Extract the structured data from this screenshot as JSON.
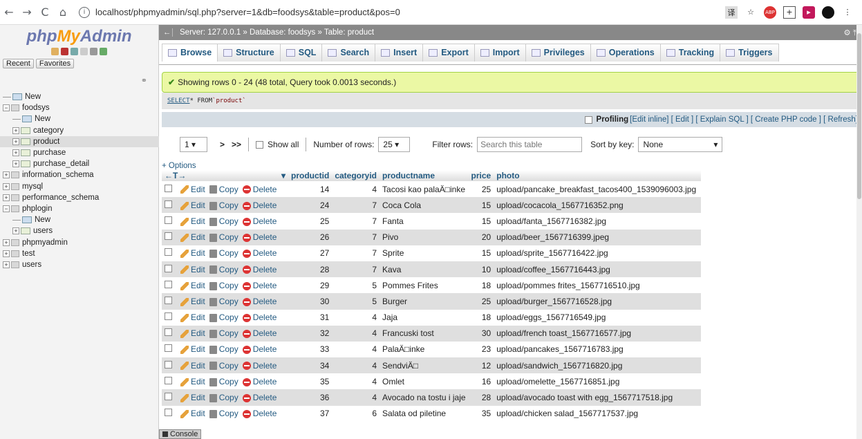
{
  "browser": {
    "url": "localhost/phpmyadmin/sql.php?server=1&db=foodsys&table=product&pos=0"
  },
  "pma": {
    "logo_php": "php",
    "logo_my": "My",
    "logo_admin": "Admin",
    "recent": "Recent",
    "favorites": "Favorites"
  },
  "tree": [
    {
      "label": "New",
      "level": 0,
      "type": "new",
      "selected": false
    },
    {
      "label": "foodsys",
      "level": 0,
      "type": "db",
      "selected": false
    },
    {
      "label": "New",
      "level": 1,
      "type": "new",
      "selected": false
    },
    {
      "label": "category",
      "level": 1,
      "type": "table",
      "selected": false
    },
    {
      "label": "product",
      "level": 1,
      "type": "table",
      "selected": true
    },
    {
      "label": "purchase",
      "level": 1,
      "type": "table",
      "selected": false
    },
    {
      "label": "purchase_detail",
      "level": 1,
      "type": "table",
      "selected": false
    },
    {
      "label": "information_schema",
      "level": 0,
      "type": "db",
      "selected": false
    },
    {
      "label": "mysql",
      "level": 0,
      "type": "db",
      "selected": false
    },
    {
      "label": "performance_schema",
      "level": 0,
      "type": "db",
      "selected": false
    },
    {
      "label": "phplogin",
      "level": 0,
      "type": "db",
      "selected": false
    },
    {
      "label": "New",
      "level": 1,
      "type": "new",
      "selected": false
    },
    {
      "label": "users",
      "level": 1,
      "type": "table",
      "selected": false
    },
    {
      "label": "phpmyadmin",
      "level": 0,
      "type": "db",
      "selected": false
    },
    {
      "label": "test",
      "level": 0,
      "type": "db",
      "selected": false
    },
    {
      "label": "users",
      "level": 0,
      "type": "db",
      "selected": false
    }
  ],
  "breadcrumb": "Server: 127.0.0.1 » Database: foodsys » Table: product",
  "tabs": [
    "Browse",
    "Structure",
    "SQL",
    "Search",
    "Insert",
    "Export",
    "Import",
    "Privileges",
    "Operations",
    "Tracking",
    "Triggers"
  ],
  "message": "Showing rows 0 - 24 (48 total, Query took 0.0013 seconds.)",
  "sql": {
    "kw": "SELECT",
    "mid": " * FROM ",
    "str": "`product`"
  },
  "profiling": {
    "label": "Profiling",
    "links": "[Edit inline] [ Edit ] [ Explain SQL ] [ Create PHP code ] [ Refresh]"
  },
  "pager": {
    "page": "1",
    "next": ">",
    "last": ">>",
    "show_all": "Show all",
    "num_rows_label": "Number of rows:",
    "num_rows": "25",
    "filter_label": "Filter rows:",
    "filter_placeholder": "Search this table",
    "sort_label": "Sort by key:",
    "sort_value": "None"
  },
  "options_label": "+ Options",
  "columns": [
    "productid",
    "categoryid",
    "productname",
    "price",
    "photo"
  ],
  "action_labels": {
    "edit": "Edit",
    "copy": "Copy",
    "delete": "Delete"
  },
  "rows": [
    [
      "14",
      "4",
      "Tacosi kao palaÄ□inke",
      "25",
      "upload/pancake_breakfast_tacos400_1539096003.jpg"
    ],
    [
      "24",
      "7",
      "Coca Cola",
      "15",
      "upload/cocacola_1567716352.png"
    ],
    [
      "25",
      "7",
      "Fanta",
      "15",
      "upload/fanta_1567716382.jpg"
    ],
    [
      "26",
      "7",
      "Pivo",
      "20",
      "upload/beer_1567716399.jpeg"
    ],
    [
      "27",
      "7",
      "Sprite",
      "15",
      "upload/sprite_1567716422.jpg"
    ],
    [
      "28",
      "7",
      "Kava",
      "10",
      "upload/coffee_1567716443.jpg"
    ],
    [
      "29",
      "5",
      "Pommes Frites",
      "18",
      "upload/pommes frites_1567716510.jpg"
    ],
    [
      "30",
      "5",
      "Burger",
      "25",
      "upload/burger_1567716528.jpg"
    ],
    [
      "31",
      "4",
      "Jaja",
      "18",
      "upload/eggs_1567716549.jpg"
    ],
    [
      "32",
      "4",
      "Francuski tost",
      "30",
      "upload/french toast_1567716577.jpg"
    ],
    [
      "33",
      "4",
      "PalaÄ□inke",
      "23",
      "upload/pancakes_1567716783.jpg"
    ],
    [
      "34",
      "4",
      "SendviÄ□",
      "12",
      "upload/sandwich_1567716820.jpg"
    ],
    [
      "35",
      "4",
      "Omlet",
      "16",
      "upload/omelette_1567716851.jpg"
    ],
    [
      "36",
      "4",
      "Avocado na tostu i jaje",
      "28",
      "upload/avocado toast with egg_1567717518.jpg"
    ],
    [
      "37",
      "6",
      "Salata od piletine",
      "35",
      "upload/chicken salad_1567717537.jpg"
    ]
  ],
  "console": "Console"
}
